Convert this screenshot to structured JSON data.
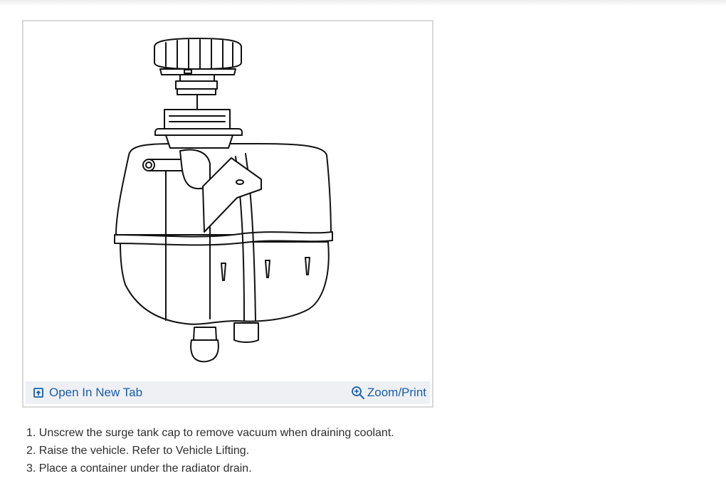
{
  "figure": {
    "open_tab_label": "Open In New Tab",
    "zoom_label": "Zoom/Print",
    "link_color": "#1a5ea8",
    "toolbar_bg": "#eef0f4"
  },
  "icons": {
    "open_tab": "open-in-new-tab-icon",
    "zoom": "zoom-in-icon"
  },
  "steps": [
    "1. Unscrew the surge tank cap to remove vacuum when draining coolant.",
    "2. Raise the vehicle. Refer to Vehicle Lifting.",
    "3. Place a container under the radiator drain."
  ]
}
